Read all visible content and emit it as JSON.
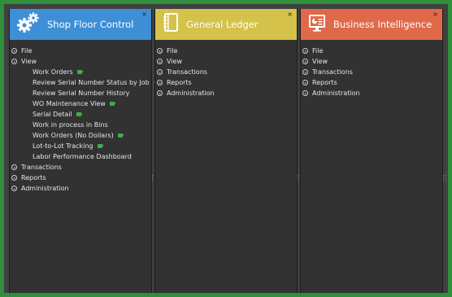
{
  "panels": [
    {
      "title": "Shop Floor Control",
      "color": "#3e8fd6",
      "icon": "gears-icon",
      "close": "×",
      "menu": [
        {
          "label": "File"
        },
        {
          "label": "View"
        }
      ],
      "view_items": [
        {
          "label": "Work Orders",
          "badge": true
        },
        {
          "label": "Review Serial Number Status by Job",
          "badge": true
        },
        {
          "label": "Review Serial Number History",
          "badge": false
        },
        {
          "label": "WO Maintenance View",
          "badge": true
        },
        {
          "label": "Serial Detail",
          "badge": true
        },
        {
          "label": "Work in process in Bins",
          "badge": false
        },
        {
          "label": "Work Orders (No Dollars)",
          "badge": true
        },
        {
          "label": "Lot-to-Lot Tracking",
          "badge": true
        },
        {
          "label": "Labor Performance Dashboard",
          "badge": false
        }
      ],
      "menu_after": [
        {
          "label": "Transactions"
        },
        {
          "label": "Reports"
        },
        {
          "label": "Administration"
        }
      ]
    },
    {
      "title": "General Ledger",
      "color": "#d4c24a",
      "icon": "ledger-icon",
      "close": "×",
      "menu": [
        {
          "label": "File"
        },
        {
          "label": "View"
        },
        {
          "label": "Transactions"
        },
        {
          "label": "Reports"
        },
        {
          "label": "Administration"
        }
      ]
    },
    {
      "title": "Business Intelligence",
      "color": "#e0694a",
      "icon": "dashboard-monitor-icon",
      "close": "×",
      "menu": [
        {
          "label": "File"
        },
        {
          "label": "View"
        },
        {
          "label": "Transactions"
        },
        {
          "label": "Reports"
        },
        {
          "label": "Administration"
        }
      ]
    }
  ]
}
